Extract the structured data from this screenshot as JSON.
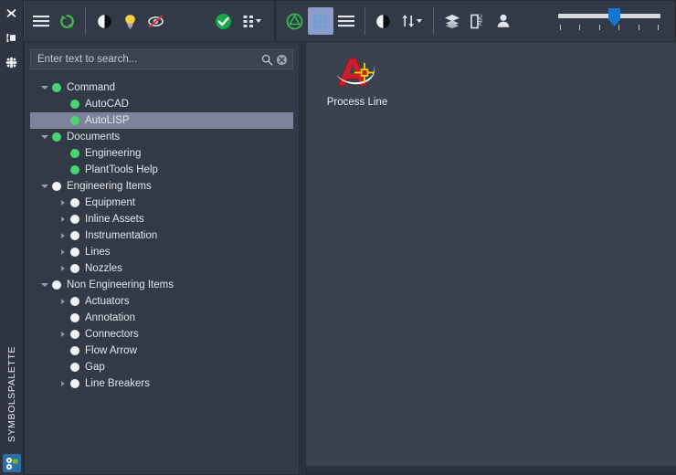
{
  "panel": {
    "vertical_title": "SYMBOLSPALETTE",
    "rail_icons": [
      {
        "name": "close-icon",
        "label": "Close"
      },
      {
        "name": "auto-hide-pin-icon",
        "label": "Auto-hide"
      },
      {
        "name": "panel-options-icon",
        "label": "Panel options"
      }
    ],
    "bottom_icon_label": "PlantTools"
  },
  "toolbar": {
    "left_group": [
      {
        "name": "menu-icon",
        "label": "Menu"
      },
      {
        "name": "refresh-icon",
        "label": "Refresh"
      }
    ],
    "display_group": [
      {
        "name": "contrast-icon",
        "label": "Contrast"
      },
      {
        "name": "lightbulb-icon",
        "label": "Highlight"
      },
      {
        "name": "no-preview-icon",
        "label": "Disable preview"
      }
    ],
    "state_group": [
      {
        "name": "check-circle-icon",
        "label": "Validate"
      },
      {
        "name": "grid-dots-icon",
        "label": "Options"
      }
    ],
    "view_group": [
      {
        "name": "shape-outline-icon",
        "label": "Symbols"
      },
      {
        "name": "grid-view-icon",
        "label": "Grid view",
        "active": true
      },
      {
        "name": "list-view-icon",
        "label": "List view",
        "active": false
      }
    ],
    "sort_group": [
      {
        "name": "contrast-icon",
        "label": "Contrast"
      },
      {
        "name": "sort-icon",
        "label": "Sort"
      }
    ],
    "meta_group": [
      {
        "name": "layers-icon",
        "label": "Layers"
      },
      {
        "name": "abc-annotation-icon",
        "label": "Annotation"
      },
      {
        "name": "person-icon",
        "label": "User"
      }
    ],
    "zoom_slider": {
      "name": "zoom-slider",
      "value": 50,
      "min": 0,
      "max": 100,
      "tick_count": 6
    }
  },
  "search": {
    "placeholder": "Enter text to search...",
    "value": "",
    "search_icon": "search-icon",
    "clear_icon": "clear-icon"
  },
  "tree": {
    "items": [
      {
        "label": "Command",
        "indent": 0,
        "twisty": "down",
        "dot": "green"
      },
      {
        "label": "AutoCAD",
        "indent": 1,
        "twisty": "none",
        "dot": "green"
      },
      {
        "label": "AutoLISP",
        "indent": 1,
        "twisty": "none",
        "dot": "green",
        "selected": true
      },
      {
        "label": "Documents",
        "indent": 0,
        "twisty": "down",
        "dot": "green"
      },
      {
        "label": "Engineering",
        "indent": 1,
        "twisty": "none",
        "dot": "green"
      },
      {
        "label": "PlantTools Help",
        "indent": 1,
        "twisty": "none",
        "dot": "green"
      },
      {
        "label": "Engineering Items",
        "indent": 0,
        "twisty": "down",
        "dot": "white"
      },
      {
        "label": "Equipment",
        "indent": 1,
        "twisty": "right",
        "dot": "white"
      },
      {
        "label": "Inline Assets",
        "indent": 1,
        "twisty": "right",
        "dot": "white"
      },
      {
        "label": "Instrumentation",
        "indent": 1,
        "twisty": "right",
        "dot": "white"
      },
      {
        "label": "Lines",
        "indent": 1,
        "twisty": "right",
        "dot": "white"
      },
      {
        "label": "Nozzles",
        "indent": 1,
        "twisty": "right",
        "dot": "white"
      },
      {
        "label": "Non Engineering Items",
        "indent": 0,
        "twisty": "down",
        "dot": "white"
      },
      {
        "label": "Actuators",
        "indent": 1,
        "twisty": "right",
        "dot": "white"
      },
      {
        "label": "Annotation",
        "indent": 1,
        "twisty": "none",
        "dot": "white"
      },
      {
        "label": "Connectors",
        "indent": 1,
        "twisty": "right",
        "dot": "white"
      },
      {
        "label": "Flow Arrow",
        "indent": 1,
        "twisty": "none",
        "dot": "white"
      },
      {
        "label": "Gap",
        "indent": 1,
        "twisty": "none",
        "dot": "white"
      },
      {
        "label": "Line Breakers",
        "indent": 1,
        "twisty": "right",
        "dot": "white"
      }
    ]
  },
  "content": {
    "symbols": [
      {
        "label": "Process Line",
        "icon": "autocad-logo-icon"
      }
    ]
  },
  "colors": {
    "panel_bg": "#333a47",
    "content_bg": "#3b424f",
    "window_bg": "#2b313c",
    "selection": "#7d839a",
    "accent_green": "#49d672",
    "accent_blue": "#1876d2",
    "active_button": "#8e9cc9",
    "text": "#e2e6ea",
    "logo_red": "#c8202a",
    "logo_yellow": "#f5d300"
  }
}
